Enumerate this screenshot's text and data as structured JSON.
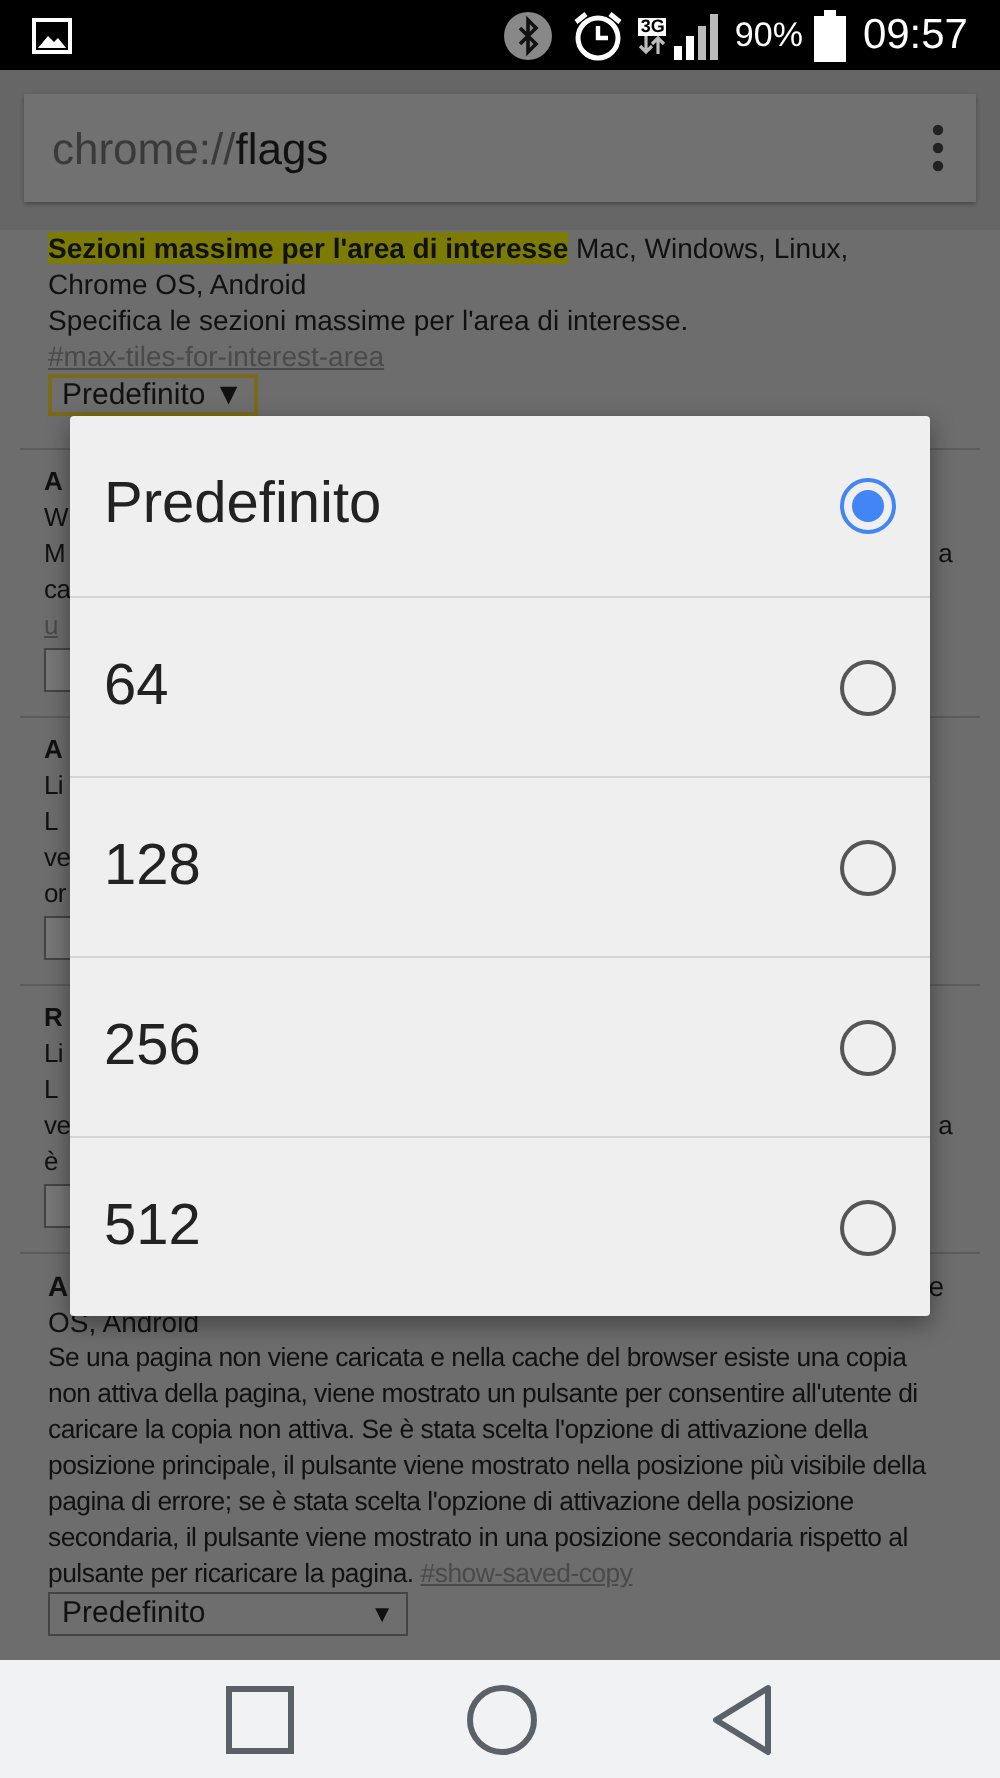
{
  "status_bar": {
    "network": "3G",
    "battery": "90%",
    "time": "09:57"
  },
  "address_bar": {
    "scheme": "chrome://",
    "path": "flags"
  },
  "flags": [
    {
      "kind": "full",
      "title": "Sezioni massime per l'area di interesse",
      "platforms": "Mac, Windows, Linux, Chrome OS, Android",
      "description": "Specifica le sezioni massime per l'area di interesse.",
      "link": "#max-tiles-for-interest-area",
      "select": "Predefinito ▼",
      "focused": true
    },
    {
      "kind": "hidden",
      "lines": [
        {
          "kind": "title",
          "left": "A"
        },
        {
          "kind": "text",
          "left": "W"
        },
        {
          "kind": "text",
          "left": "M",
          "right": "a"
        },
        {
          "kind": "text",
          "left": "ca"
        },
        {
          "kind": "link",
          "left": "u"
        },
        {
          "kind": "select"
        }
      ]
    },
    {
      "kind": "hidden",
      "lines": [
        {
          "kind": "title",
          "left": "A"
        },
        {
          "kind": "text",
          "left": "Li"
        },
        {
          "kind": "text",
          "left": "L"
        },
        {
          "kind": "text",
          "left": "ve"
        },
        {
          "kind": "text",
          "left": "or"
        },
        {
          "kind": "select"
        }
      ]
    },
    {
      "kind": "hidden",
      "lines": [
        {
          "kind": "title",
          "left": "R"
        },
        {
          "kind": "text",
          "left": "Li"
        },
        {
          "kind": "text",
          "left": "L"
        },
        {
          "kind": "text",
          "left": "ve",
          "right": "a"
        },
        {
          "kind": "text",
          "left": "è"
        },
        {
          "kind": "select"
        }
      ]
    },
    {
      "kind": "tail",
      "title_left": "A",
      "title_right": "e",
      "platforms": "OS, Android",
      "description": "Se una pagina non viene caricata e nella cache del browser esiste una copia non attiva della pagina, viene mostrato un pulsante per consentire all'utente di caricare la copia non attiva. Se è stata scelta l'opzione di attivazione della posizione principale, il pulsante viene mostrato nella posizione più visibile della pagina di errore; se è stata scelta l'opzione di attivazione della posizione secondaria, il pulsante viene mostrato in una posizione secondaria rispetto al pulsante per ricaricare la pagina.",
      "link": "#show-saved-copy",
      "select": "Predefinito",
      "select_arrow": "▼"
    }
  ],
  "dialog": {
    "options": [
      {
        "label": "Predefinito",
        "selected": true
      },
      {
        "label": "64",
        "selected": false
      },
      {
        "label": "128",
        "selected": false
      },
      {
        "label": "256",
        "selected": false
      },
      {
        "label": "512",
        "selected": false
      }
    ]
  }
}
